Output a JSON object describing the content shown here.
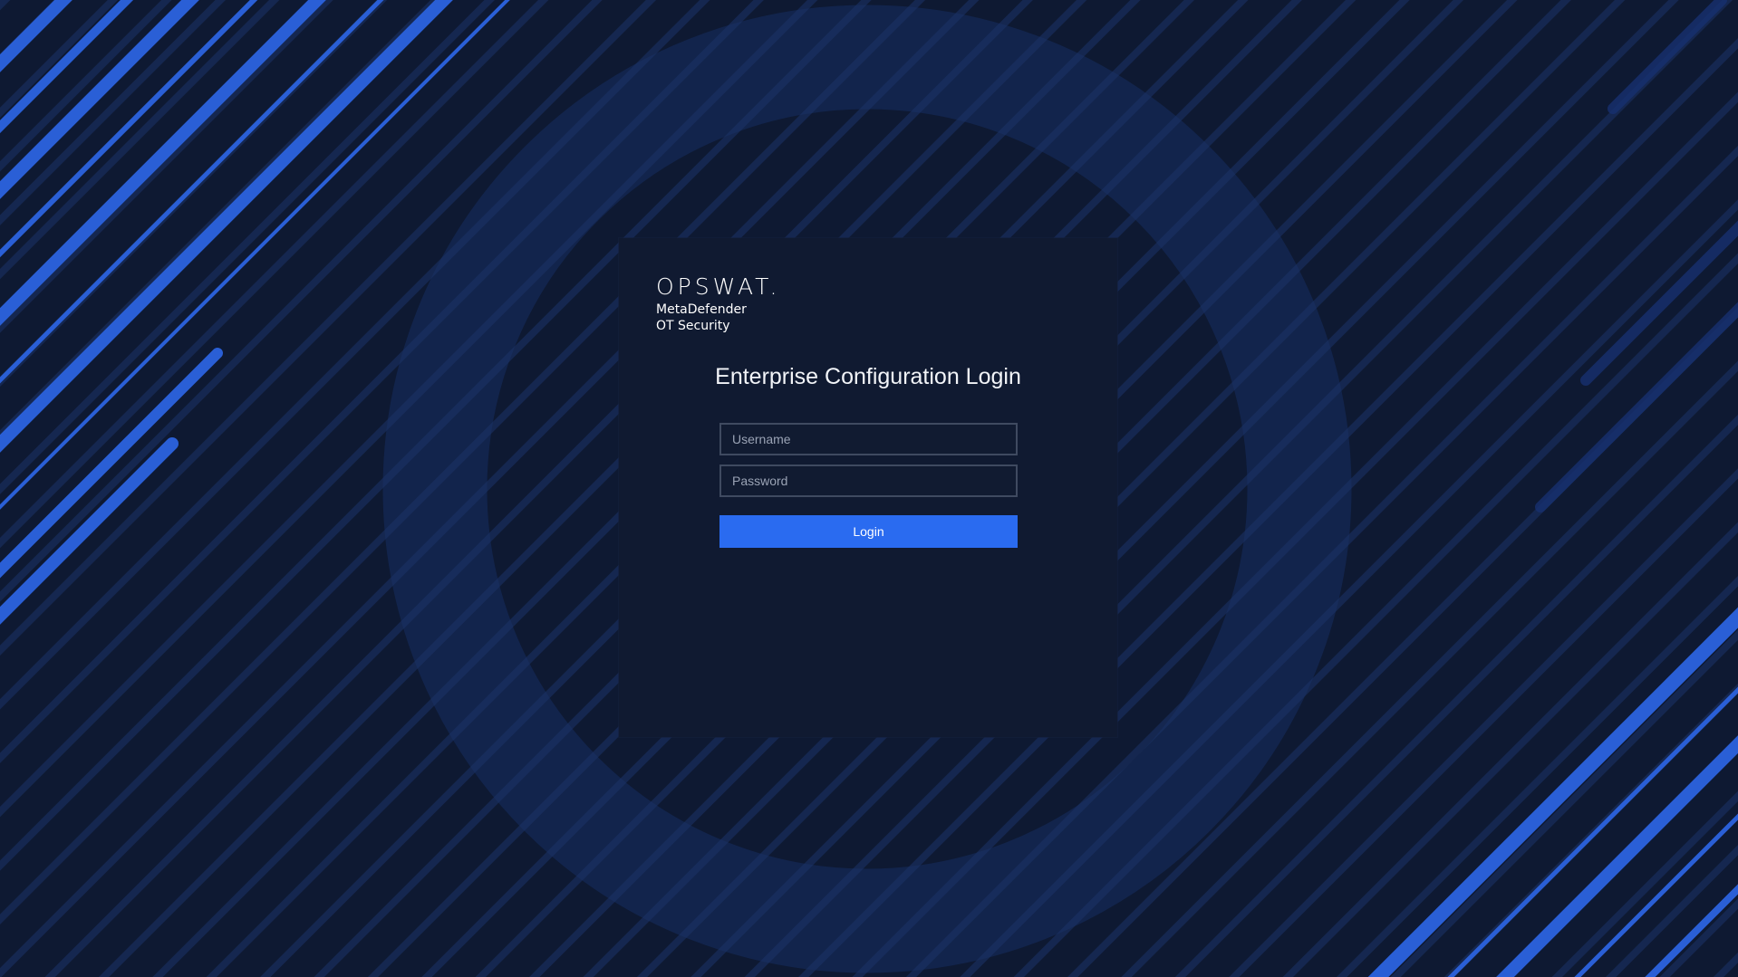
{
  "brand": {
    "wordmark": "OPSWAT.",
    "product_line1": "MetaDefender",
    "product_line2": "OT Security"
  },
  "login": {
    "title": "Enterprise Configuration Login",
    "username_placeholder": "Username",
    "password_placeholder": "Password",
    "username_value": "",
    "password_value": "",
    "button_label": "Login"
  },
  "colors": {
    "background": "#0f1a33",
    "panel": "#101a31",
    "accent": "#2a6bf0",
    "stripe": "#2b62d8"
  }
}
